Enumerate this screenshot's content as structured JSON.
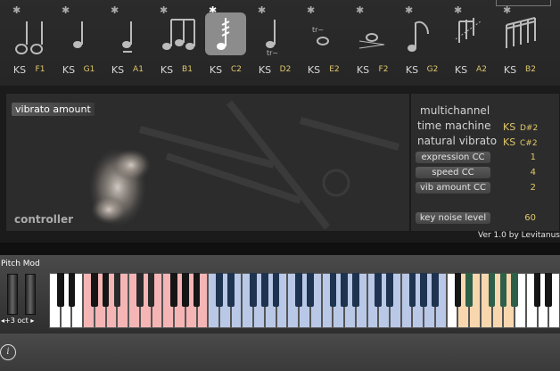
{
  "articulations": [
    {
      "name": "sustain",
      "ks": "KS",
      "note": "F1",
      "active": true
    },
    {
      "name": "sustain-2",
      "ks": "KS",
      "note": "G1",
      "active": false
    },
    {
      "name": "staccato",
      "ks": "KS",
      "note": "A1",
      "active": false
    },
    {
      "name": "legato",
      "ks": "KS",
      "note": "B1",
      "active": false
    },
    {
      "name": "tremolo",
      "ks": "KS",
      "note": "C2",
      "active": false
    },
    {
      "name": "trill-whole",
      "ks": "KS",
      "note": "D2",
      "active": false
    },
    {
      "name": "trill-half",
      "ks": "KS",
      "note": "E2",
      "active": false
    },
    {
      "name": "crescendo",
      "ks": "KS",
      "note": "F2",
      "active": false
    },
    {
      "name": "fall",
      "ks": "KS",
      "note": "G2",
      "active": false
    },
    {
      "name": "run",
      "ks": "KS",
      "note": "A2",
      "active": false
    },
    {
      "name": "fast-run",
      "ks": "KS",
      "note": "B2",
      "active": false
    }
  ],
  "main": {
    "vibrato_label": "vibrato amount",
    "controller_label": "controller"
  },
  "side": {
    "multichannel": "multichannel",
    "time_machine": "time machine",
    "time_machine_ks": "KS",
    "time_machine_note": "D#2",
    "natural_vibrato": "natural vibrato",
    "natural_vibrato_ks": "KS",
    "natural_vibrato_note": "C#2",
    "expression_label": "expression CC",
    "expression_value": "1",
    "speed_label": "speed CC",
    "speed_value": "4",
    "vib_label": "vib amount CC",
    "vib_value": "2",
    "keynoise_label": "key noise level",
    "keynoise_value": "60"
  },
  "version": "Ver 1.0 by Levitanus",
  "keyboard": {
    "pitch_mod": "Pitch Mod",
    "octave": "◂+3 oct ▸",
    "colors": {
      "red": "#f5b5b5",
      "blue": "#b9c8e6",
      "orange": "#f8d7ae",
      "green": "#2e5f48",
      "dark_blue": "#1e3350"
    }
  },
  "footer": {
    "info_icon": "i"
  }
}
